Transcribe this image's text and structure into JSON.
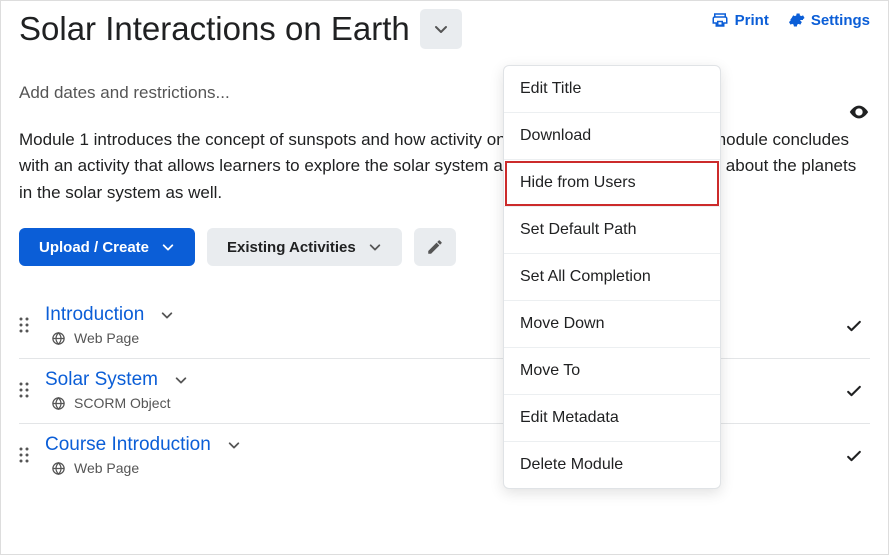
{
  "header": {
    "title": "Solar Interactions on Earth",
    "print": "Print",
    "settings": "Settings"
  },
  "meta": {
    "restrictions": "Add dates and restrictions...",
    "description": "Module 1 introduces the concept of sunspots and how activity on the Sun affects Earth. The module concludes with an activity that allows learners to explore the solar system and learn valuable information about the planets in the solar system as well."
  },
  "buttons": {
    "upload": "Upload / Create",
    "existing": "Existing Activities"
  },
  "menu": {
    "items": [
      "Edit Title",
      "Download",
      "Hide from Users",
      "Set Default Path",
      "Set All Completion",
      "Move Down",
      "Move To",
      "Edit Metadata",
      "Delete Module"
    ],
    "highlight_index": 2
  },
  "content": [
    {
      "title": "Introduction",
      "type": "Web Page"
    },
    {
      "title": "Solar System",
      "type": "SCORM Object"
    },
    {
      "title": "Course Introduction",
      "type": "Web Page"
    }
  ]
}
